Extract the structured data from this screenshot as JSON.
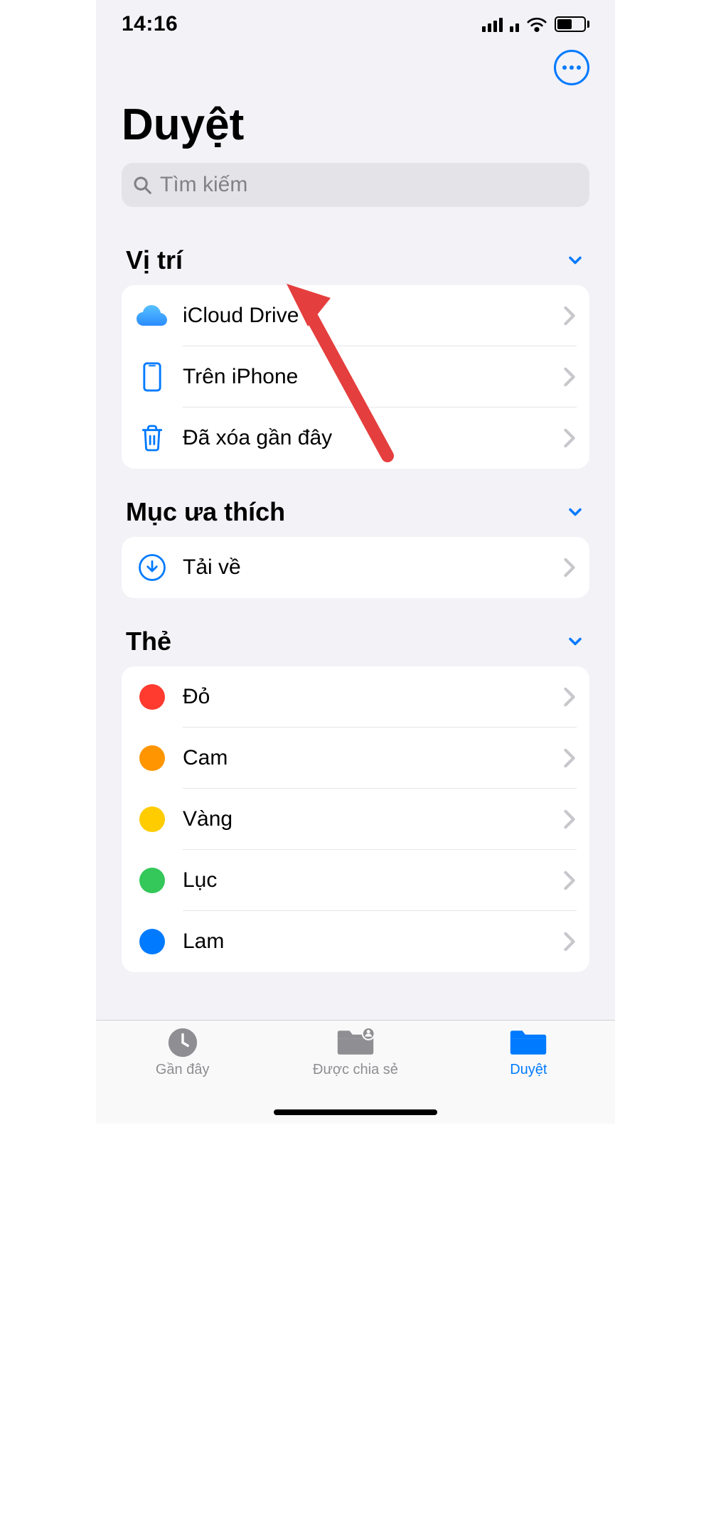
{
  "status": {
    "time": "14:16",
    "signal_icon": "signal-icon",
    "wifi_icon": "wifi-icon",
    "battery_icon": "battery-icon",
    "battery_level_percent": 55
  },
  "header": {
    "title": "Duyệt",
    "more_icon": "ellipsis-circle-icon"
  },
  "search": {
    "placeholder": "Tìm kiếm",
    "icon": "search-icon"
  },
  "sections": {
    "locations": {
      "title": "Vị trí",
      "expanded": true,
      "items": [
        {
          "icon": "icloud-icon",
          "label": "iCloud Drive"
        },
        {
          "icon": "iphone-icon",
          "label": "Trên iPhone"
        },
        {
          "icon": "trash-icon",
          "label": "Đã xóa gần đây"
        }
      ]
    },
    "favorites": {
      "title": "Mục ưa thích",
      "expanded": true,
      "items": [
        {
          "icon": "download-circle-icon",
          "label": "Tải về"
        }
      ]
    },
    "tags": {
      "title": "Thẻ",
      "expanded": true,
      "items": [
        {
          "color": "#ff3b30",
          "label": "Đỏ"
        },
        {
          "color": "#ff9500",
          "label": "Cam"
        },
        {
          "color": "#ffcc00",
          "label": "Vàng"
        },
        {
          "color": "#34c759",
          "label": "Lục"
        },
        {
          "color": "#007aff",
          "label": "Lam"
        }
      ]
    }
  },
  "annotation": {
    "type": "arrow",
    "color": "#e53e3e",
    "points_to": "iCloud Drive"
  },
  "tabs": {
    "items": [
      {
        "icon": "clock-icon",
        "label": "Gần đây",
        "active": false
      },
      {
        "icon": "shared-folder-icon",
        "label": "Được chia sẻ",
        "active": false
      },
      {
        "icon": "folder-icon",
        "label": "Duyệt",
        "active": true
      }
    ]
  }
}
